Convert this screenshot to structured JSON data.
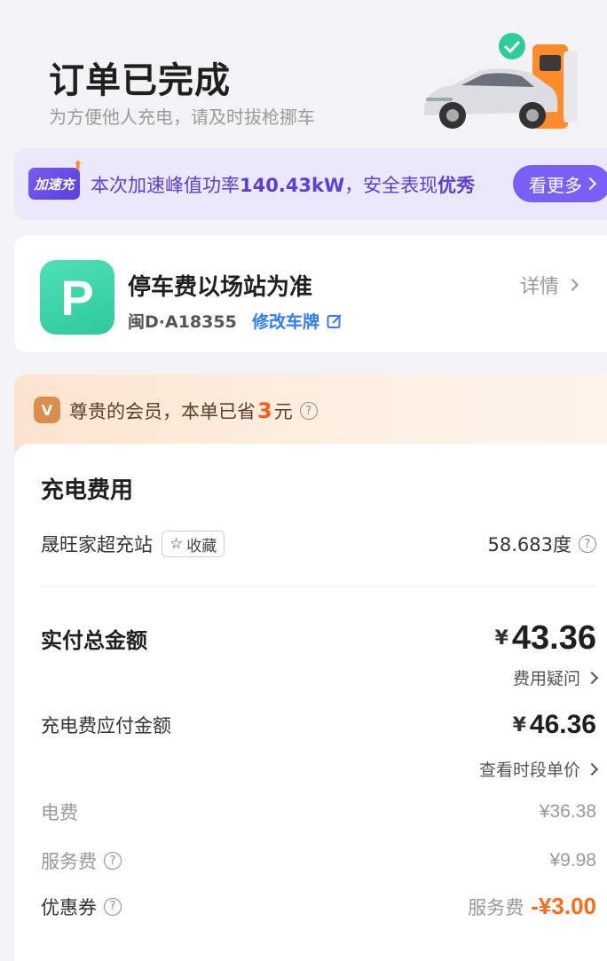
{
  "header": {
    "title": "订单已完成",
    "subtitle": "为方便他人充电，请及时拔枪挪车"
  },
  "boost": {
    "badge": "加速充",
    "text_prefix": "本次加速峰值功率",
    "power": "140.43kW",
    "text_mid": "，安全表现",
    "rating": "优秀",
    "more_label": "看更多"
  },
  "parking": {
    "icon_letter": "P",
    "title": "停车费以场站为准",
    "plate": "闽D·A18355",
    "edit_label": "修改车牌",
    "detail_label": "详情"
  },
  "member": {
    "text_prefix": "尊贵的会员，本单已省",
    "saved": "3",
    "text_suffix": "元"
  },
  "fee": {
    "title": "充电费用",
    "station": "晟旺家超充站",
    "fav_label": "收藏",
    "energy": "58.683度",
    "total_label": "实付总金额",
    "total_currency": "¥",
    "total_amount": "43.36",
    "question_link": "费用疑问",
    "due_label": "充电费应付金额",
    "due_currency": "¥",
    "due_amount": "46.36",
    "period_link": "查看时段单价",
    "electricity_label": "电费",
    "electricity_amount": "¥36.38",
    "service_label": "服务费",
    "service_amount": "¥9.98",
    "coupon_label": "优惠券",
    "coupon_type": "服务费",
    "coupon_amount": "-¥3.00"
  },
  "colors": {
    "accent_purple": "#7a5ff5",
    "link_blue": "#2f7df6",
    "discount_orange": "#ff6a1a",
    "parking_green": "#2dc99c"
  }
}
